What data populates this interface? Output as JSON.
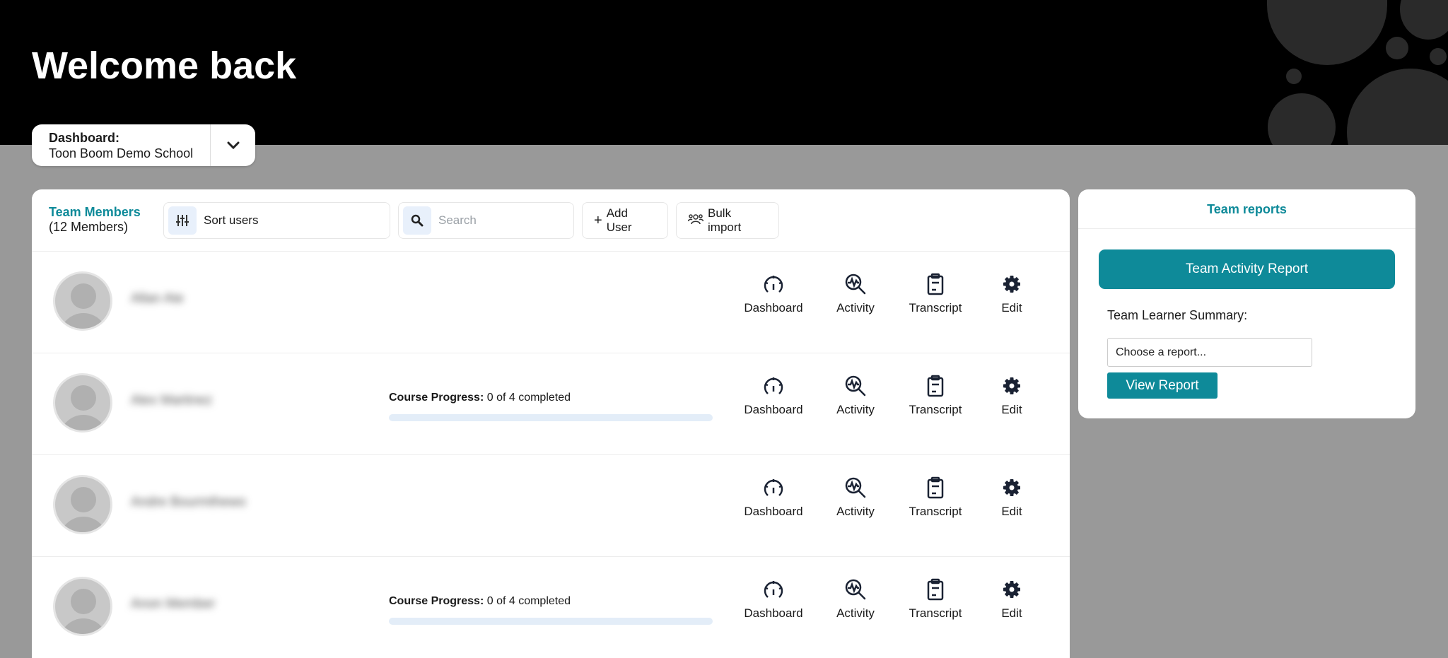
{
  "header": {
    "title": "Welcome back"
  },
  "dashboard_selector": {
    "label": "Dashboard:",
    "value": "Toon Boom Demo School"
  },
  "team_members": {
    "title": "Team Members",
    "count": "(12 Members)",
    "sort_label": "Sort users",
    "search_placeholder": "Search",
    "add_user_label": "Add User",
    "bulk_import_label": "Bulk import",
    "actions": {
      "dashboard": "Dashboard",
      "activity": "Activity",
      "transcript": "Transcript",
      "edit": "Edit"
    },
    "rows": [
      {
        "name": "Allan Ate",
        "progress": null
      },
      {
        "name": "Alex Martinez",
        "progress": {
          "label": "Course Progress:",
          "text": "0 of 4 completed",
          "fraction": 0
        }
      },
      {
        "name": "Andre Bourmthewo",
        "progress": null
      },
      {
        "name": "Anon Member",
        "progress": {
          "label": "Course Progress:",
          "text": "0 of 4 completed",
          "fraction": 0
        }
      }
    ]
  },
  "team_reports": {
    "title": "Team reports",
    "activity_button": "Team Activity Report",
    "learner_summary_label": "Team Learner Summary:",
    "select_placeholder": "Choose a report...",
    "view_button": "View Report"
  },
  "colors": {
    "accent": "#0e8a99",
    "hero": "#000000",
    "page_bg": "#999999",
    "progress_track": "#e3edf8"
  }
}
